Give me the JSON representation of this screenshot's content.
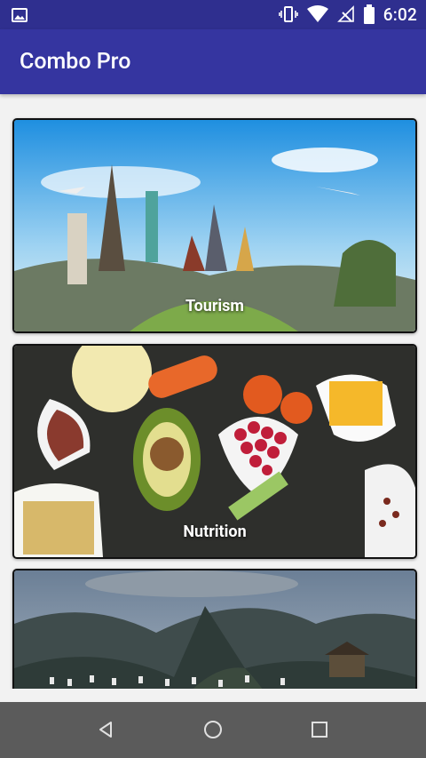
{
  "app": {
    "title": "Combo Pro"
  },
  "status_bar": {
    "time": "6:02",
    "icons": [
      "image-icon",
      "vibrate-icon",
      "wifi-icon",
      "no-signal-icon",
      "battery-icon"
    ]
  },
  "cards": [
    {
      "label": "Tourism"
    },
    {
      "label": "Nutrition"
    },
    {
      "label": ""
    }
  ],
  "colors": {
    "app_bar": "#3535a0",
    "status_bar": "#2f2f8f",
    "nav_bar": "#5b5b5b",
    "background": "#f2f2f2"
  },
  "nav_bar": {
    "buttons": [
      "back-icon",
      "home-icon",
      "recents-icon"
    ]
  }
}
